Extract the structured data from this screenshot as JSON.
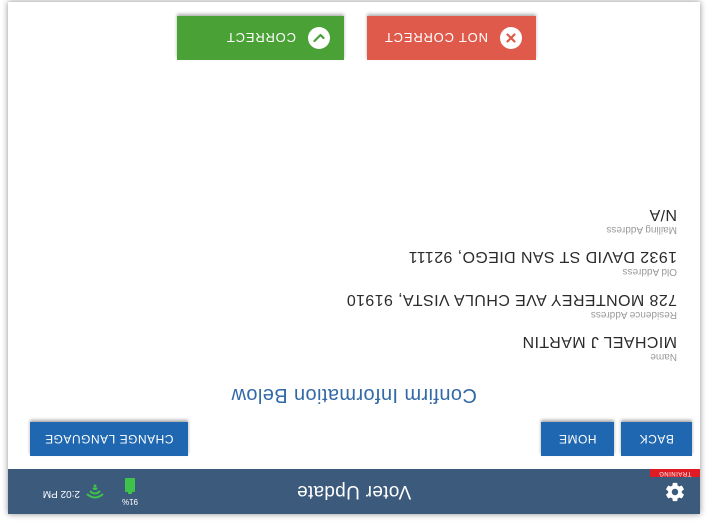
{
  "header": {
    "title": "Voter Update",
    "training_badge": "TRAINING",
    "battery_percent": "91%",
    "time": "2:02 PM",
    "settings_icon": "gear-icon",
    "signal_icon": "wifi-signal-icon",
    "battery_icon": "battery-icon"
  },
  "nav": {
    "back": "BACK",
    "home": "HOME",
    "change_language": "CHANGE LANGUAGE"
  },
  "main": {
    "heading": "Confirm Information Below",
    "fields": [
      {
        "label": "Name",
        "value": "MICHAEL J MARTIN"
      },
      {
        "label": "Residence Address",
        "value": "728 MONTEREY AVE CHULA VISTA, 91910"
      },
      {
        "label": "Old Address",
        "value": "1932 DAVID ST SAN DIEGO, 92111"
      },
      {
        "label": "Mailing Address",
        "value": "N/A"
      }
    ]
  },
  "actions": {
    "not_correct": "NOT CORRECT",
    "correct": "CORRECT",
    "not_correct_icon": "x-circle-icon",
    "correct_icon": "check-circle-icon"
  },
  "colors": {
    "header_bg": "#3c5a7c",
    "primary_button": "#1f67b1",
    "heading_text": "#3269a8",
    "not_correct": "#e05a4b",
    "correct": "#4aa136",
    "training_badge": "#e01b24",
    "battery_fill": "#3fc24a"
  }
}
